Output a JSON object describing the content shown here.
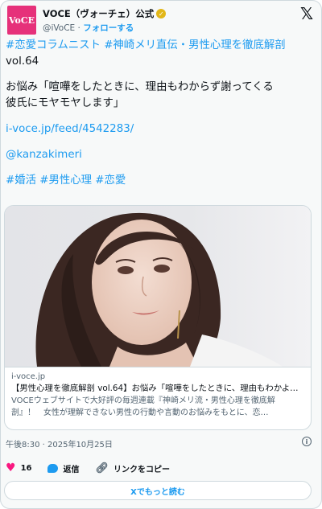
{
  "account": {
    "avatar_text": "VoCE",
    "name": "VOCE（ヴォーチェ）公式",
    "verified_glyph": "✓",
    "handle": "@iVoCE",
    "separator": "·",
    "follow_label": "フォローする",
    "brand_color": "#e6317a"
  },
  "x_logo": "𝕏",
  "post": {
    "hashtags_line1": "#恋愛コラムニスト #神崎メリ直伝・男性心理を徹底解剖",
    "line2": "vol.64",
    "line3": "お悩み「喧嘩をしたときに、理由もわからず謝ってくる",
    "line4": "彼氏にモヤモヤします」",
    "link": "i-voce.jp/feed/4542283/",
    "mention": "@kanzakimeri",
    "hashtags_line2": "#婚活 #男性心理 #恋愛"
  },
  "preview": {
    "domain": "i-voce.jp",
    "title": "【男性心理を徹底解剖 vol.64】お悩み「喧嘩をしたときに、理由もわかよ…",
    "desc_line1": "VOCEウェブサイトで大好評の毎週連載『神崎メリ流・男性心理を徹底解",
    "desc_line2": "剖』！　女性が理解できない男性の行動や言動のお悩みをもとに、恋…"
  },
  "meta": {
    "timestamp": "午後8:30 · 2025年10月25日",
    "info_glyph": "i"
  },
  "actions": {
    "like_count": "16",
    "reply_label": "返信",
    "copy_link_label": "リンクをコピー"
  },
  "more_button_label": "Xでもっと読む",
  "colors": {
    "link": "#1d9bf0",
    "heart": "#f91880",
    "verified": "#e2b719"
  }
}
